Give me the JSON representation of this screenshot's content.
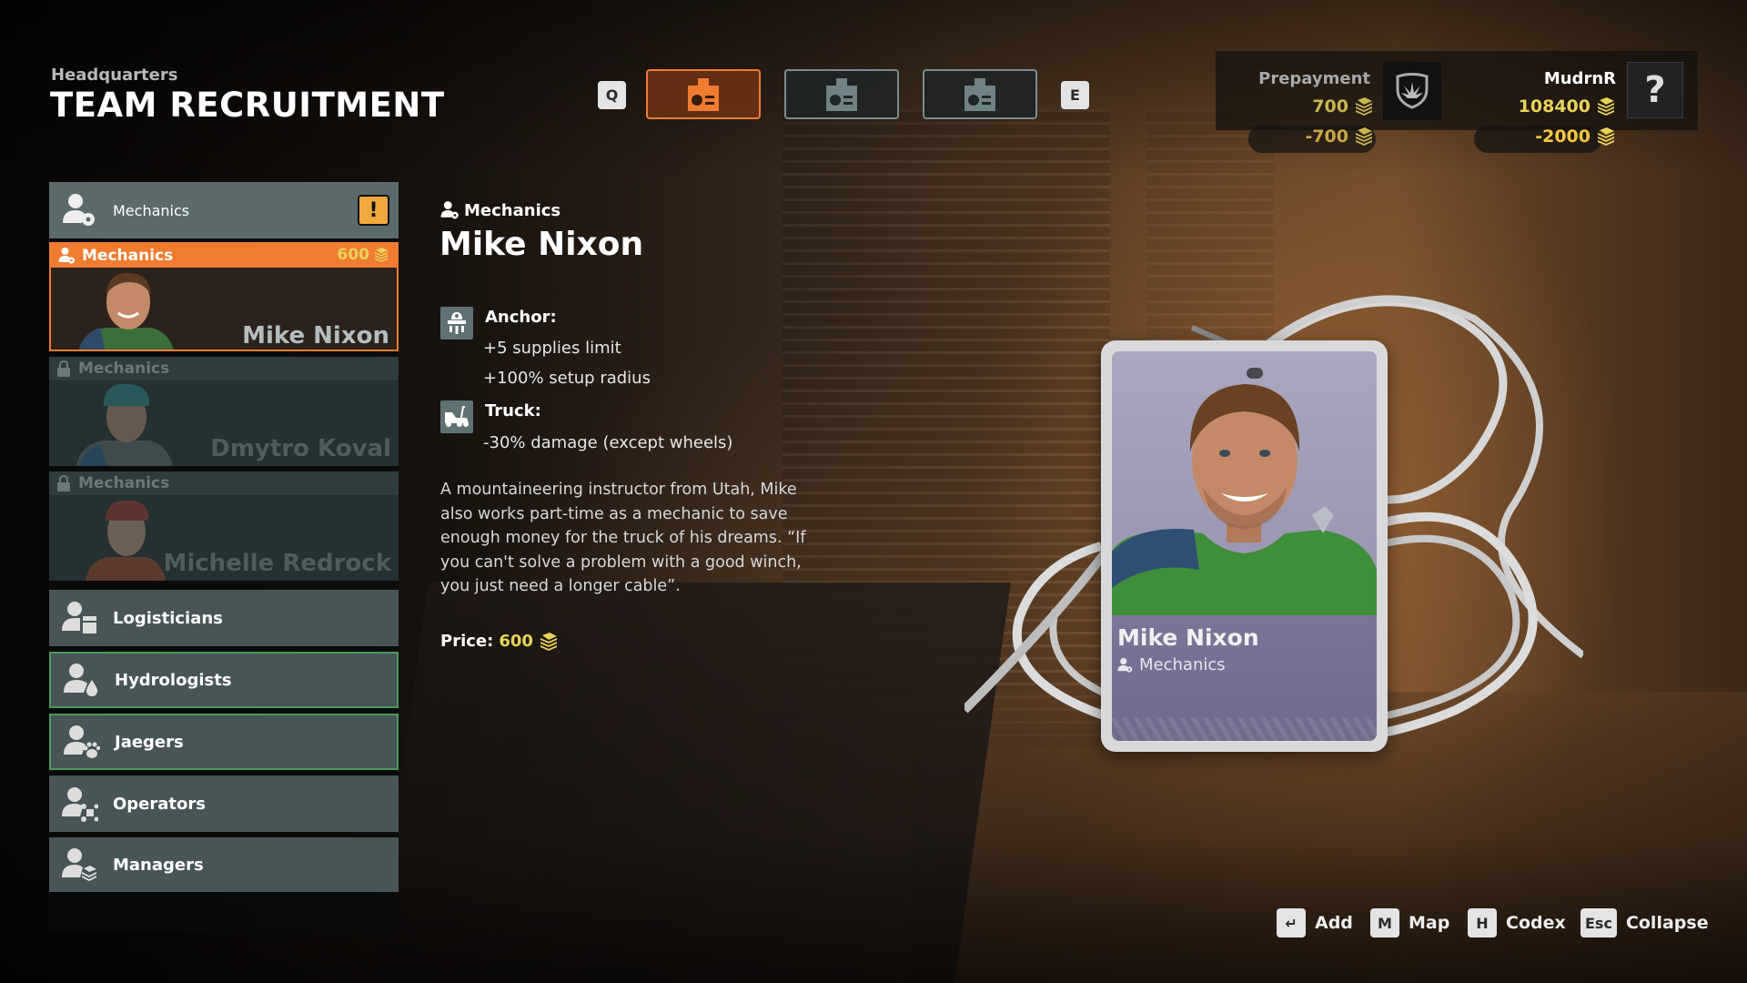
{
  "header": {
    "subtitle": "Headquarters",
    "title": "TEAM RECRUITMENT"
  },
  "top_tabs": {
    "prev_key": "Q",
    "next_key": "E",
    "tabs": [
      {
        "icon": "id-badge-icon",
        "active": true
      },
      {
        "icon": "id-badge-icon",
        "active": false
      },
      {
        "icon": "id-badge-icon",
        "active": false
      }
    ]
  },
  "resources": {
    "prepayment_label": "Prepayment",
    "prepayment_value": "700",
    "prepayment_change": "-700",
    "faction_icon": "shield-emblem-icon",
    "player_name": "MudrnR",
    "player_balance": "108400",
    "player_change": "-2000",
    "help_icon": "?"
  },
  "sidebar": {
    "active_category": {
      "label": "Mechanics",
      "icon": "person-gear-icon",
      "alert": "!"
    },
    "employees": [
      {
        "role": "Mechanics",
        "name": "Mike Nixon",
        "price": "600",
        "state": "selected"
      },
      {
        "role": "Mechanics",
        "name": "Dmytro Koval",
        "state": "locked"
      },
      {
        "role": "Mechanics",
        "name": "Michelle Redrock",
        "state": "locked"
      }
    ],
    "categories": [
      {
        "label": "Logisticians",
        "icon": "person-boxes-icon",
        "highlight": false
      },
      {
        "label": "Hydrologists",
        "icon": "person-drop-icon",
        "highlight": true
      },
      {
        "label": "Jaegers",
        "icon": "person-paw-icon",
        "highlight": true
      },
      {
        "label": "Operators",
        "icon": "person-drone-icon",
        "highlight": false
      },
      {
        "label": "Managers",
        "icon": "person-money-icon",
        "highlight": false
      }
    ]
  },
  "detail": {
    "role": "Mechanics",
    "name": "Mike Nixon",
    "perks": [
      {
        "title": "Anchor:",
        "icon": "anchor-lamp-icon",
        "lines": [
          "+5 supplies limit",
          "+100% setup radius"
        ]
      },
      {
        "title": "Truck:",
        "icon": "truck-tow-icon",
        "lines": [
          "-30% damage (except wheels)"
        ]
      }
    ],
    "description": "A mountaineering instructor from Utah, Mike also works part-time as a mechanic to save enough money for the truck of his dreams. “If you can't solve a problem with a good winch, you just need a longer cable”.",
    "price_label": "Price:",
    "price_value": "600"
  },
  "id_card": {
    "name": "Mike Nixon",
    "role": "Mechanics"
  },
  "footer_hints": [
    {
      "key": "↵",
      "label": "Add"
    },
    {
      "key": "M",
      "label": "Map"
    },
    {
      "key": "H",
      "label": "Codex"
    },
    {
      "key": "Esc",
      "label": "Collapse"
    }
  ],
  "colors": {
    "accent_orange": "#f07c32",
    "money_yellow": "#e7d45a",
    "alert_yellow": "#f2a93b",
    "category_bg": "#485557",
    "highlight_green": "#4c9a58"
  }
}
